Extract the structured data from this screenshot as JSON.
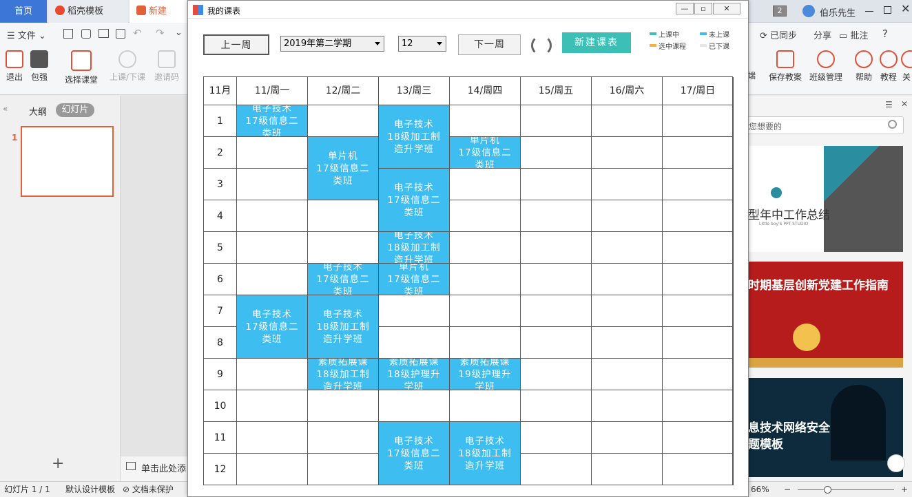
{
  "tabs": {
    "home": "首页",
    "templates": "稻壳模板",
    "new_ppt": "新建 PPT",
    "badge": "2",
    "user": "伯乐先生"
  },
  "toolbar": {
    "file": "文件",
    "exit": "退出",
    "baoqiang": "包强",
    "select_class": "选择课堂",
    "class_toggle": "上课/下课",
    "invite": "邀请码",
    "sync": "已同步",
    "share": "分享",
    "comment": "批注",
    "help_q": "?",
    "duan": "端",
    "save_plan": "保存教案",
    "class_mgmt": "班级管理",
    "help": "帮助",
    "tutorial": "教程",
    "more": "关"
  },
  "left": {
    "outline": "大纲",
    "slides": "幻灯片",
    "slide_no": "1",
    "add": "+",
    "notes": "单击此处添"
  },
  "right": {
    "search_placeholder": "您想要的",
    "t1": "型年中工作总结",
    "t1sub": "Little boy'S PPT STUDIO",
    "t2": "时期基层创新党建工作指南",
    "t3a": "息技术网络安全",
    "t3b": "题模板"
  },
  "status": {
    "slide": "幻灯片 1 / 1",
    "design": "默认设计模板",
    "protect": "文档未保护",
    "zoom": "66%"
  },
  "dialog": {
    "title": "我的课表",
    "prev_week": "上一周",
    "semester": "2019年第二学期",
    "week": "12",
    "next_week": "下一周",
    "new_schedule": "新建课表",
    "legend": {
      "in_class": "上课中",
      "not_started": "未上课",
      "selected": "选中课程",
      "finished": "已下课"
    },
    "colors": {
      "in_class": "#3cbfb4",
      "not_started": "#3dbdf0",
      "selected": "#f5b041",
      "finished": "#e6e6e6"
    },
    "month_header": "11月",
    "days": [
      "11/周一",
      "12/周二",
      "13/周三",
      "14/周四",
      "15/周五",
      "16/周六",
      "17/周日"
    ],
    "periods": [
      "1",
      "2",
      "3",
      "4",
      "5",
      "6",
      "7",
      "8",
      "9",
      "10",
      "11",
      "12"
    ],
    "courses": [
      {
        "day": 0,
        "start": 1,
        "span": 1,
        "lines": [
          "电子技术",
          "17级信息二",
          "类班"
        ]
      },
      {
        "day": 1,
        "start": 2,
        "span": 2,
        "lines": [
          "单片机",
          "17级信息二",
          "类班"
        ]
      },
      {
        "day": 2,
        "start": 1,
        "span": 2,
        "lines": [
          "电子技术",
          "18级加工制",
          "造升学班"
        ]
      },
      {
        "day": 3,
        "start": 2,
        "span": 1,
        "lines": [
          "单片机",
          "17级信息二",
          "类班"
        ]
      },
      {
        "day": 2,
        "start": 3,
        "span": 2,
        "lines": [
          "电子技术",
          "17级信息二",
          "类班"
        ]
      },
      {
        "day": 2,
        "start": 5,
        "span": 1,
        "lines": [
          "电子技术",
          "18级加工制",
          "造升学班"
        ]
      },
      {
        "day": 1,
        "start": 6,
        "span": 1,
        "lines": [
          "电子技术",
          "17级信息二",
          "类班"
        ]
      },
      {
        "day": 2,
        "start": 6,
        "span": 1,
        "lines": [
          "单片机",
          "17级信息二",
          "类班"
        ]
      },
      {
        "day": 0,
        "start": 7,
        "span": 2,
        "lines": [
          "电子技术",
          "17级信息二",
          "类班"
        ]
      },
      {
        "day": 1,
        "start": 7,
        "span": 2,
        "lines": [
          "电子技术",
          "18级加工制",
          "造升学班"
        ]
      },
      {
        "day": 1,
        "start": 9,
        "span": 1,
        "lines": [
          "素质拓展课",
          "18级加工制",
          "造升学班"
        ]
      },
      {
        "day": 2,
        "start": 9,
        "span": 1,
        "lines": [
          "素质拓展课",
          "18级护理升",
          "学班"
        ]
      },
      {
        "day": 3,
        "start": 9,
        "span": 1,
        "lines": [
          "素质拓展课",
          "19级护理升",
          "学班"
        ]
      },
      {
        "day": 2,
        "start": 11,
        "span": 2,
        "lines": [
          "电子技术",
          "17级信息二",
          "类班"
        ]
      },
      {
        "day": 3,
        "start": 11,
        "span": 2,
        "lines": [
          "电子技术",
          "18级加工制",
          "造升学班"
        ]
      }
    ]
  }
}
